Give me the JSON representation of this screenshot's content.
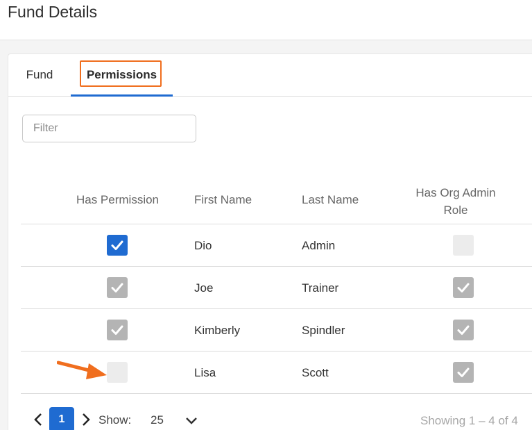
{
  "page": {
    "title": "Fund Details"
  },
  "tabs": [
    {
      "label": "Fund",
      "active": false
    },
    {
      "label": "Permissions",
      "active": true
    }
  ],
  "filter": {
    "placeholder": "Filter",
    "value": ""
  },
  "table": {
    "headers": {
      "has_permission": "Has Permission",
      "first_name": "First Name",
      "last_name": "Last Name",
      "has_org_admin_role_line1": "Has Org Admin",
      "has_org_admin_role_line2": "Role"
    },
    "rows": [
      {
        "first_name": "Dio",
        "last_name": "Admin",
        "has_permission": "checked-active",
        "has_org_admin_role": "unchecked"
      },
      {
        "first_name": "Joe",
        "last_name": "Trainer",
        "has_permission": "checked-disabled",
        "has_org_admin_role": "checked-disabled"
      },
      {
        "first_name": "Kimberly",
        "last_name": "Spindler",
        "has_permission": "checked-disabled",
        "has_org_admin_role": "checked-disabled"
      },
      {
        "first_name": "Lisa",
        "last_name": "Scott",
        "has_permission": "unchecked",
        "has_org_admin_role": "checked-disabled"
      }
    ]
  },
  "pagination": {
    "current_page": "1",
    "show_label": "Show:",
    "page_size": "25",
    "summary": "Showing 1 – 4 of 4"
  },
  "colors": {
    "accent": "#1f6bd1",
    "annotation": "#f06e1e",
    "disabled_check": "#b4b4b4"
  },
  "icons": [
    "check-icon",
    "chevron-left-icon",
    "chevron-right-icon",
    "chevron-down-icon",
    "annotation-arrow-icon"
  ]
}
